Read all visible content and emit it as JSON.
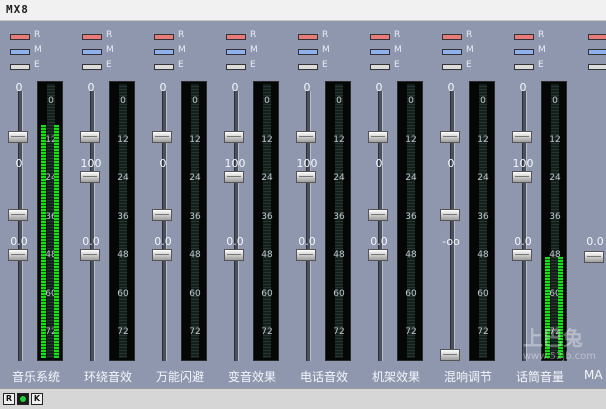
{
  "window": {
    "title": "MX8"
  },
  "led_labels": {
    "r": "R",
    "m": "M",
    "e": "E"
  },
  "channels": [
    {
      "name": "音乐系统",
      "v1": "0",
      "v2": "0",
      "v3": "0.0",
      "meter_level": 0.85
    },
    {
      "name": "环绕音效",
      "v1": "0",
      "v2": "100",
      "v3": "0.0",
      "meter_level": 0
    },
    {
      "name": "万能闪避",
      "v1": "0",
      "v2": "0",
      "v3": "0.0",
      "meter_level": 0
    },
    {
      "name": "变音效果",
      "v1": "0",
      "v2": "100",
      "v3": "0.0",
      "meter_level": 0
    },
    {
      "name": "电话音效",
      "v1": "0",
      "v2": "100",
      "v3": "0.0",
      "meter_level": 0
    },
    {
      "name": "机架效果",
      "v1": "0",
      "v2": "0",
      "v3": "0.0",
      "meter_level": 0
    },
    {
      "name": "混响调节",
      "v1": "0",
      "v2": "0",
      "v3": "-oo",
      "meter_level": 0
    },
    {
      "name": "话筒音量",
      "v1": "0",
      "v2": "100",
      "v3": "0.0",
      "meter_level": 0.37
    }
  ],
  "partial_channel": {
    "value": "0.0",
    "label": "MA"
  },
  "meter_scale": [
    "0",
    "12",
    "24",
    "36",
    "48",
    "60",
    "72"
  ],
  "status_buttons": [
    "R",
    "",
    "K"
  ],
  "watermark": {
    "main": "上巴兔",
    "sub": "www.52jb.com"
  }
}
